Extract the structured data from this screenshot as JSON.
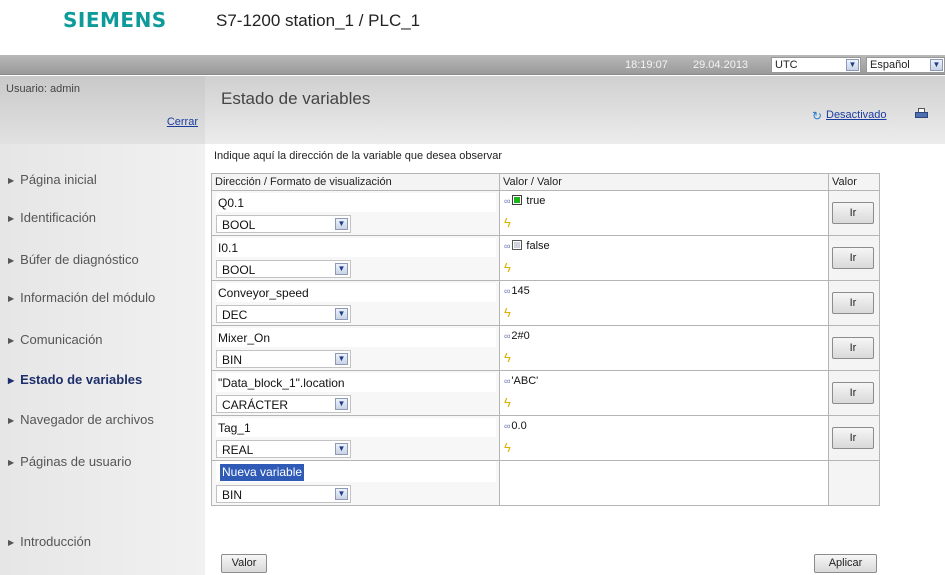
{
  "header": {
    "brand": "SIEMENS",
    "station": "S7-1200 station_1 / PLC_1"
  },
  "topbar": {
    "time": "18:19:07",
    "date": "29.04.2013",
    "timezone": "UTC",
    "language": "Español"
  },
  "user": {
    "label": "Usuario: admin",
    "logout": "Cerrar"
  },
  "page": {
    "title": "Estado de variables",
    "status_link": "Desactivado",
    "instruction": "Indique aquí la dirección de la variable que desea observar"
  },
  "nav": [
    {
      "label": "Página inicial",
      "active": false
    },
    {
      "label": "Identificación",
      "active": false
    },
    {
      "label": "Búfer de diagnóstico",
      "active": false
    },
    {
      "label": "Información del módulo",
      "active": false
    },
    {
      "label": "Comunicación",
      "active": false
    },
    {
      "label": "Estado de variables",
      "active": true
    },
    {
      "label": "Navegador de archivos",
      "active": false
    },
    {
      "label": "Páginas de usuario",
      "active": false
    },
    {
      "label": "Introducción",
      "active": false
    }
  ],
  "table": {
    "headers": [
      "Dirección / Formato de visualización",
      "Valor / Valor",
      "Valor"
    ],
    "rows": [
      {
        "address": "Q0.1",
        "format": "BOOL",
        "value": "true",
        "led": "on",
        "button": "Ir"
      },
      {
        "address": "I0.1",
        "format": "BOOL",
        "value": "false",
        "led": "off",
        "button": "Ir"
      },
      {
        "address": "Conveyor_speed",
        "format": "DEC",
        "value": "145",
        "led": "none",
        "button": "Ir"
      },
      {
        "address": "Mixer_On",
        "format": "BIN",
        "value": "2#0",
        "led": "none",
        "button": "Ir"
      },
      {
        "address": "\"Data_block_1\".location",
        "format": "CARÁCTER",
        "value": "'ABC'",
        "led": "none",
        "button": "Ir"
      },
      {
        "address": "Tag_1",
        "format": "REAL",
        "value": "0.0",
        "led": "none",
        "button": "Ir"
      }
    ],
    "new_row": {
      "address": "Nueva variable",
      "format": "BIN"
    }
  },
  "buttons": {
    "valor": "Valor",
    "aplicar": "Aplicar"
  },
  "icons": {
    "refresh": "refresh-icon",
    "print": "print-icon",
    "link": "link-icon",
    "modify": "lightning-icon",
    "dropdown": "chevron-down-icon"
  },
  "colors": {
    "brand": "#0f9a9a",
    "link": "#1a3c9e",
    "led_on": "#1fb21f",
    "selection": "#2f5bb7"
  }
}
